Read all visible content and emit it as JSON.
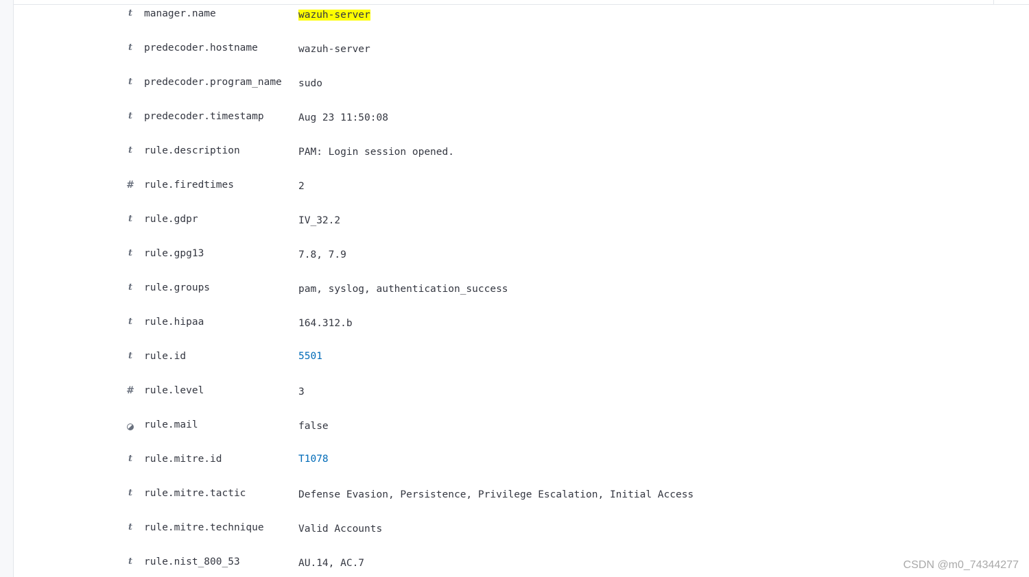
{
  "fields": [
    {
      "icon": "t",
      "icon_name": "string-type-icon",
      "name": "manager.name",
      "value": "wazuh-server",
      "highlight": true
    },
    {
      "icon": "t",
      "icon_name": "string-type-icon",
      "name": "predecoder.hostname",
      "value": "wazuh-server"
    },
    {
      "icon": "t",
      "icon_name": "string-type-icon",
      "name": "predecoder.program_name",
      "value": "sudo"
    },
    {
      "icon": "t",
      "icon_name": "string-type-icon",
      "name": "predecoder.timestamp",
      "value": "Aug 23 11:50:08"
    },
    {
      "icon": "t",
      "icon_name": "string-type-icon",
      "name": "rule.description",
      "value": "PAM: Login session opened."
    },
    {
      "icon": "#",
      "icon_name": "number-type-icon",
      "name": "rule.firedtimes",
      "value": "2"
    },
    {
      "icon": "t",
      "icon_name": "string-type-icon",
      "name": "rule.gdpr",
      "value": "IV_32.2"
    },
    {
      "icon": "t",
      "icon_name": "string-type-icon",
      "name": "rule.gpg13",
      "value": "7.8, 7.9"
    },
    {
      "icon": "t",
      "icon_name": "string-type-icon",
      "name": "rule.groups",
      "value": "pam, syslog, authentication_success"
    },
    {
      "icon": "t",
      "icon_name": "string-type-icon",
      "name": "rule.hipaa",
      "value": "164.312.b"
    },
    {
      "icon": "t",
      "icon_name": "string-type-icon",
      "name": "rule.id",
      "value": "5501",
      "link": true
    },
    {
      "icon": "#",
      "icon_name": "number-type-icon",
      "name": "rule.level",
      "value": "3"
    },
    {
      "icon": "",
      "icon_name": "boolean-type-icon",
      "name": "rule.mail",
      "value": "false"
    },
    {
      "icon": "t",
      "icon_name": "string-type-icon",
      "name": "rule.mitre.id",
      "value": "T1078",
      "link": true
    },
    {
      "icon": "t",
      "icon_name": "string-type-icon",
      "name": "rule.mitre.tactic",
      "value": "Defense Evasion, Persistence, Privilege Escalation, Initial Access"
    },
    {
      "icon": "t",
      "icon_name": "string-type-icon",
      "name": "rule.mitre.technique",
      "value": "Valid Accounts"
    },
    {
      "icon": "t",
      "icon_name": "string-type-icon",
      "name": "rule.nist_800_53",
      "value": "AU.14, AC.7"
    }
  ],
  "colors": {
    "highlight": "#fdfd00",
    "link": "#006bb8",
    "text": "#343741",
    "icon": "#69707d"
  },
  "watermark": "CSDN @m0_74344277"
}
